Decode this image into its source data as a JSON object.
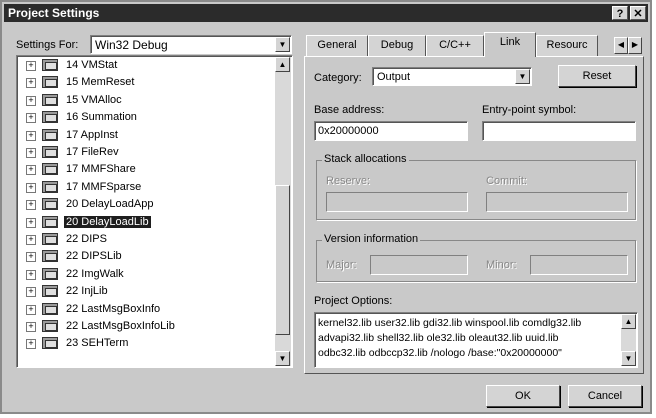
{
  "window": {
    "title": "Project Settings",
    "help_glyph": "?",
    "close_glyph": "✕"
  },
  "settings_for": {
    "label": "Settings For:",
    "value": "Win32 Debug"
  },
  "tree": {
    "items": [
      {
        "label": "14 VMStat"
      },
      {
        "label": "15 MemReset"
      },
      {
        "label": "15 VMAlloc"
      },
      {
        "label": "16 Summation"
      },
      {
        "label": "17 AppInst"
      },
      {
        "label": "17 FileRev"
      },
      {
        "label": "17 MMFShare"
      },
      {
        "label": "17 MMFSparse"
      },
      {
        "label": "20 DelayLoadApp"
      },
      {
        "label": "20 DelayLoadLib",
        "selected": true
      },
      {
        "label": "22 DIPS"
      },
      {
        "label": "22 DIPSLib"
      },
      {
        "label": "22 ImgWalk"
      },
      {
        "label": "22 InjLib"
      },
      {
        "label": "22 LastMsgBoxInfo"
      },
      {
        "label": "22 LastMsgBoxInfoLib"
      },
      {
        "label": "23 SEHTerm"
      }
    ],
    "expand_glyph": "+"
  },
  "tabs": [
    {
      "label": "General"
    },
    {
      "label": "Debug"
    },
    {
      "label": "C/C++"
    },
    {
      "label": "Link",
      "active": true
    },
    {
      "label": "Resourc"
    }
  ],
  "tab_scroll": {
    "left": "◀",
    "right": "▶"
  },
  "link": {
    "category_label": "Category:",
    "category_value": "Output",
    "reset_label": "Reset",
    "base_address_label": "Base address:",
    "base_address_value": "0x20000000",
    "entry_point_label": "Entry-point symbol:",
    "entry_point_value": "",
    "stack_group": "Stack allocations",
    "reserve_label": "Reserve:",
    "commit_label": "Commit:",
    "version_group": "Version information",
    "major_label": "Major:",
    "minor_label": "Minor:",
    "project_options_label": "Project Options:",
    "project_options_lines": [
      "kernel32.lib user32.lib gdi32.lib winspool.lib comdlg32.lib",
      "advapi32.lib shell32.lib ole32.lib oleaut32.lib uuid.lib",
      "odbc32.lib odbccp32.lib /nologo /base:\"0x20000000\""
    ]
  },
  "buttons": {
    "ok": "OK",
    "cancel": "Cancel"
  },
  "glyphs": {
    "down": "▼",
    "up": "▲"
  }
}
